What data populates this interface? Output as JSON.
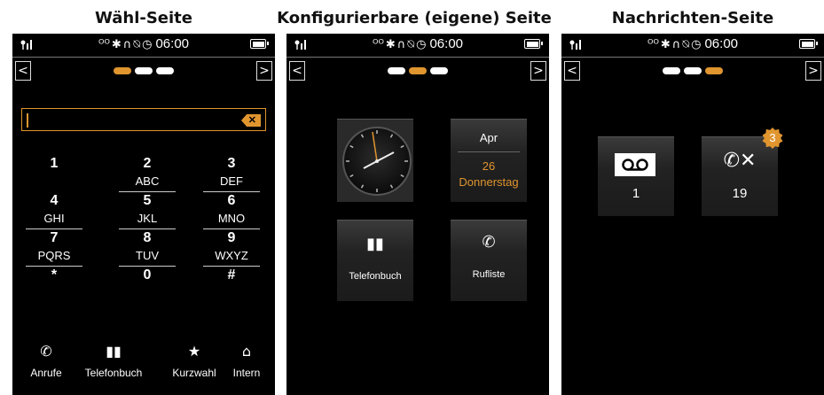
{
  "titles": {
    "dial": "Wähl-Seite",
    "custom": "Konfigurierbare (eigene) Seite",
    "messages": "Nachrichten-Seite"
  },
  "status": {
    "time": "06:00",
    "icons": [
      "signal-icon",
      "voicemail-icon",
      "bluetooth-icon",
      "headset-icon",
      "ringer-off-icon",
      "alarm-clock-icon",
      "battery-icon"
    ]
  },
  "nav": {
    "prev": "<",
    "next": ">"
  },
  "colors": {
    "accent": "#e0952f",
    "screen_bg": "#000000",
    "tile_bg": "#2a2a2a"
  },
  "dial": {
    "input_value": "",
    "keys": [
      {
        "num": "1",
        "letters": ""
      },
      {
        "num": "2",
        "letters": "ABC"
      },
      {
        "num": "3",
        "letters": "DEF"
      },
      {
        "num": "4",
        "letters": "GHI"
      },
      {
        "num": "5",
        "letters": "JKL"
      },
      {
        "num": "6",
        "letters": "MNO"
      },
      {
        "num": "7",
        "letters": "PQRS"
      },
      {
        "num": "8",
        "letters": "TUV"
      },
      {
        "num": "9",
        "letters": "WXYZ"
      },
      {
        "num": "*",
        "letters": ""
      },
      {
        "num": "0",
        "letters": ""
      },
      {
        "num": "#",
        "letters": ""
      }
    ],
    "bottom": [
      {
        "label": "Anrufe",
        "icon": "call-list-icon"
      },
      {
        "label": "Telefonbuch",
        "icon": "phonebook-icon"
      },
      {
        "label": "Kurzwahl",
        "icon": "star-icon"
      },
      {
        "label": "Intern",
        "icon": "home-icon"
      }
    ]
  },
  "custom": {
    "calendar": {
      "month": "Apr",
      "day": "26",
      "weekday": "Donnerstag"
    },
    "phonebook_label": "Telefonbuch",
    "calllist_label": "Rufliste"
  },
  "messages": {
    "voicemail_count": "1",
    "missed_calls_count": "19",
    "missed_calls_badge": "3"
  }
}
